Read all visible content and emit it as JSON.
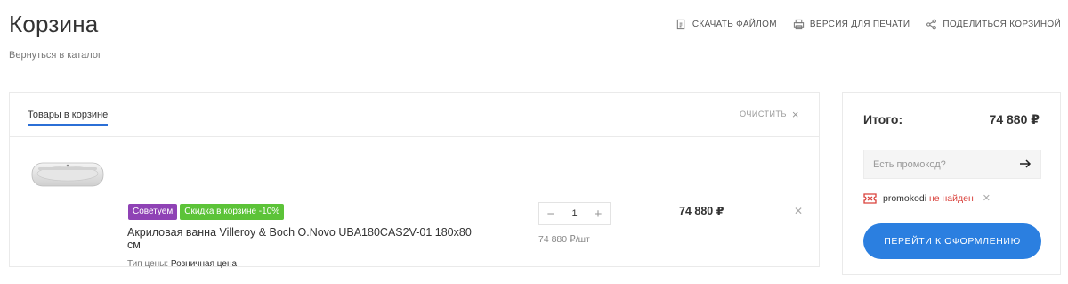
{
  "header": {
    "title": "Корзина",
    "back_link": "Вернуться в каталог",
    "actions": [
      {
        "label": "СКАЧАТЬ ФАЙЛОМ",
        "icon": "download-file-icon"
      },
      {
        "label": "ВЕРСИЯ ДЛЯ ПЕЧАТИ",
        "icon": "printer-icon"
      },
      {
        "label": "ПОДЕЛИТЬСЯ КОРЗИНОЙ",
        "icon": "share-icon"
      }
    ]
  },
  "cart": {
    "tab_label": "Товары в корзине",
    "clear_label": "ОЧИСТИТЬ",
    "items": [
      {
        "image_icon": "bathtub-image",
        "badges": [
          "Советуем",
          "Скидка в корзине -10%"
        ],
        "name_line1": "Акриловая ванна Villeroy & Boch O.Novo UBA180CAS2V-01 180x80",
        "name_line2": "см",
        "price_type_label": "Тип цены:",
        "price_type_value": "Розничная цена",
        "quantity": "1",
        "unit_price": "74 880 ₽/шт",
        "total": "74 880 ₽"
      }
    ]
  },
  "summary": {
    "total_label": "Итого:",
    "total_value": "74 880 ₽",
    "promo_placeholder": "Есть промокод?",
    "coupon_code": "promokodi",
    "coupon_status": "не найден",
    "checkout_label": "ПЕРЕЙТИ К ОФОРМЛЕНИЮ"
  },
  "colors": {
    "accent": "#2b7fe0",
    "badge_recommend": "#8f42b5",
    "badge_discount": "#5cc338",
    "error": "#d9403a"
  }
}
